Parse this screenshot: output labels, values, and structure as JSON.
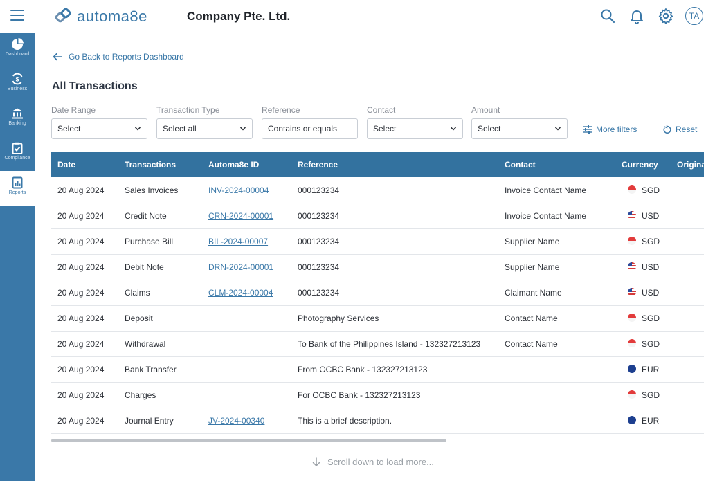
{
  "header": {
    "logo_text": "automa8e",
    "company": "Company Pte. Ltd.",
    "avatar_initials": "TA",
    "icons": [
      "search-icon",
      "bell-icon",
      "gear-icon"
    ]
  },
  "sidebar": {
    "items": [
      {
        "label": "Dashboard",
        "icon": "pie-chart-icon"
      },
      {
        "label": "Business",
        "icon": "dollar-cycle-icon"
      },
      {
        "label": "Banking",
        "icon": "bank-icon"
      },
      {
        "label": "Compliance",
        "icon": "clipboard-check-icon"
      },
      {
        "label": "Reports",
        "icon": "report-chart-icon",
        "active": true
      }
    ]
  },
  "nav": {
    "back_label": "Go Back to Reports Dashboard"
  },
  "page": {
    "title": "All Transactions"
  },
  "filters": {
    "date_range": {
      "label": "Date Range",
      "value": "Select"
    },
    "transaction_type": {
      "label": "Transaction Type",
      "value": "Select all"
    },
    "reference": {
      "label": "Reference",
      "value": "Contains or equals"
    },
    "contact": {
      "label": "Contact",
      "value": "Select"
    },
    "amount": {
      "label": "Amount",
      "value": "Select"
    },
    "more_filters": "More filters",
    "reset": "Reset"
  },
  "table": {
    "headers": [
      "Date",
      "Transactions",
      "Automa8e ID",
      "Reference",
      "Contact",
      "Currency",
      "Original"
    ],
    "rows": [
      [
        "20 Aug 2024",
        "Sales Invoices",
        "INV-2024-00004",
        "000123234",
        "Invoice Contact Name",
        "SGD"
      ],
      [
        "20 Aug 2024",
        "Credit Note",
        "CRN-2024-00001",
        "000123234",
        "Invoice Contact Name",
        "USD"
      ],
      [
        "20 Aug 2024",
        "Purchase Bill",
        "BIL-2024-00007",
        "000123234",
        "Supplier Name",
        "SGD"
      ],
      [
        "20 Aug 2024",
        "Debit Note",
        "DRN-2024-00001",
        "000123234",
        "Supplier Name",
        "USD"
      ],
      [
        "20 Aug 2024",
        "Claims",
        "CLM-2024-00004",
        "000123234",
        "Claimant Name",
        "USD"
      ],
      [
        "20 Aug 2024",
        "Deposit",
        "",
        "Photography Services",
        "Contact Name",
        "SGD"
      ],
      [
        "20 Aug 2024",
        "Withdrawal",
        "",
        "To Bank of the Philippines Island  - 132327213123",
        "Contact Name",
        "SGD"
      ],
      [
        "20 Aug 2024",
        "Bank Transfer",
        "",
        "From OCBC Bank  - 132327213123",
        "",
        "EUR"
      ],
      [
        "20 Aug 2024",
        "Charges",
        "",
        "For OCBC Bank  - 132327213123",
        "",
        "SGD"
      ],
      [
        "20 Aug 2024",
        "Journal Entry",
        "JV-2024-00340",
        "This is a brief description.",
        "",
        "EUR"
      ]
    ]
  },
  "footer": {
    "load_more": "Scroll down to load more..."
  },
  "colors": {
    "brand": "#3a78a8",
    "header_row": "#33729f"
  }
}
